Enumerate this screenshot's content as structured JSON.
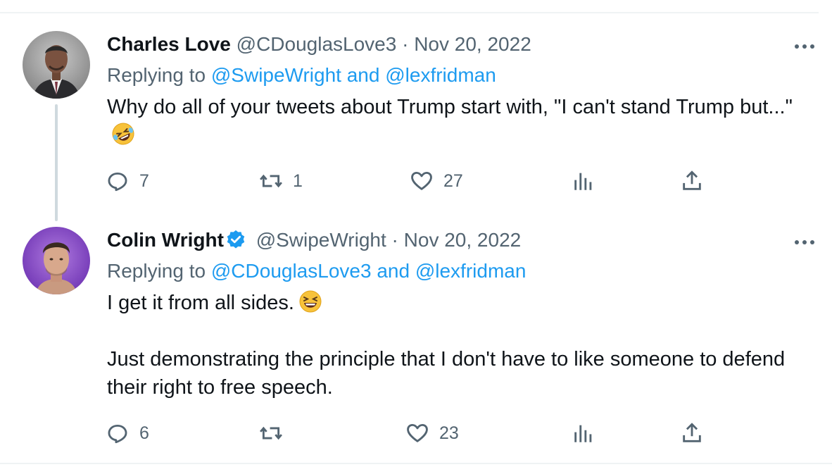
{
  "tweets": [
    {
      "name": "Charles Love",
      "handle": "@CDouglasLove3",
      "separator": "·",
      "date": "Nov 20, 2022",
      "replying_prefix": "Replying to",
      "mentions": [
        "@SwipeWright",
        "@lexfridman"
      ],
      "mention_joiner": "and",
      "text": "Why do all of your tweets about Trump start with, \"I can't stand Trump but...\"",
      "emoji": "rolling-on-floor-laughing-emoji",
      "counts": {
        "replies": "7",
        "retweets": "1",
        "likes": "27"
      },
      "verified": false
    },
    {
      "name": "Colin Wright",
      "handle": "@SwipeWright",
      "separator": "·",
      "date": "Nov 20, 2022",
      "replying_prefix": "Replying to",
      "mentions": [
        "@CDouglasLove3",
        "@lexfridman"
      ],
      "mention_joiner": "and",
      "text_line1": "I get it from all sides.",
      "emoji": "grinning-squinting-face-emoji",
      "text_para2": "Just demonstrating the principle that I don't have to like someone to defend their right to free speech.",
      "counts": {
        "replies": "6",
        "retweets": "",
        "likes": "23"
      },
      "verified": true
    }
  ],
  "colors": {
    "text": "#0f1419",
    "secondary": "#536471",
    "accent": "#1d9bf0",
    "divider": "#eff3f4",
    "thread_line": "#cfd9de"
  },
  "icons": [
    "reply-icon",
    "retweet-icon",
    "like-icon",
    "views-icon",
    "share-icon",
    "more-icon",
    "verified-badge-icon"
  ]
}
